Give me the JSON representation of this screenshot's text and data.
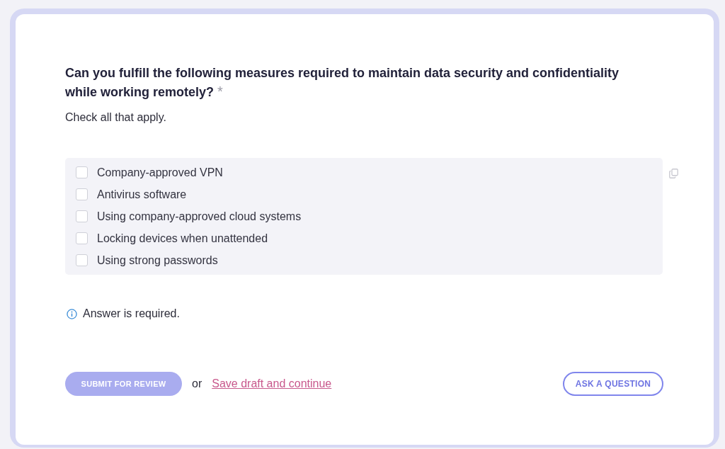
{
  "question": {
    "title": "Can you fulfill the following measures required to maintain data security and confidentiality while working remotely?",
    "required_mark": "*",
    "hint": "Check all that apply."
  },
  "options": [
    {
      "label": "Company-approved VPN",
      "checked": false
    },
    {
      "label": "Antivirus software",
      "checked": false
    },
    {
      "label": "Using company-approved cloud systems",
      "checked": false
    },
    {
      "label": "Locking devices when unattended",
      "checked": false
    },
    {
      "label": "Using strong passwords",
      "checked": false
    }
  ],
  "validation": {
    "message": "Answer is required."
  },
  "actions": {
    "submit": {
      "label": "SUBMIT FOR REVIEW",
      "disabled": true
    },
    "separator": "or",
    "save_link": "Save draft and continue",
    "ask": "ASK A QUESTION"
  }
}
